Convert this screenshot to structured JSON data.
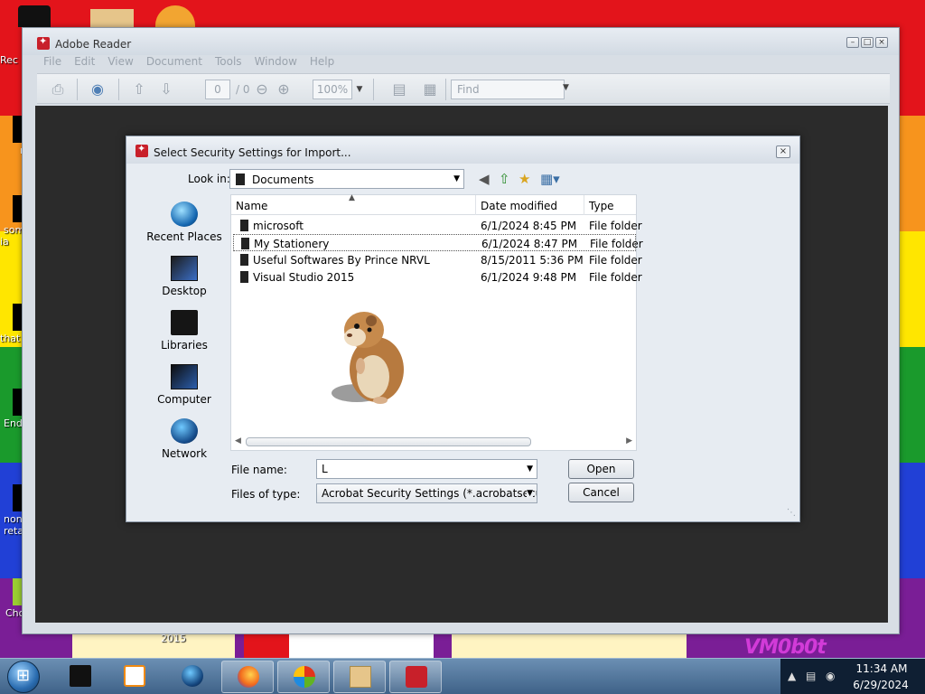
{
  "desktop": {
    "icons": [
      {
        "label": "Rec"
      },
      {
        "label": "r"
      },
      {
        "label": "som ia"
      },
      {
        "label": "that"
      },
      {
        "label": "End"
      },
      {
        "label": "none retar"
      },
      {
        "label": "Cho"
      }
    ],
    "taskbar_year_label": "2015",
    "watermark": "VM0b0t"
  },
  "reader": {
    "title": "Adobe Reader",
    "menu": [
      "File",
      "Edit",
      "View",
      "Document",
      "Tools",
      "Window",
      "Help"
    ],
    "toolbar": {
      "page_current": "0",
      "page_total": "/ 0",
      "zoom": "100%",
      "find_placeholder": "Find"
    }
  },
  "dialog": {
    "title": "Select Security Settings for Import...",
    "look_in_label": "Look in:",
    "look_in_value": "Documents",
    "places": [
      {
        "label": "Recent Places",
        "icon": "recent-places-icon"
      },
      {
        "label": "Desktop",
        "icon": "desktop-icon"
      },
      {
        "label": "Libraries",
        "icon": "libraries-icon"
      },
      {
        "label": "Computer",
        "icon": "computer-icon"
      },
      {
        "label": "Network",
        "icon": "network-icon"
      }
    ],
    "columns": [
      "Name",
      "Date modified",
      "Type"
    ],
    "files": [
      {
        "name": "microsoft",
        "date": "6/1/2024 8:45 PM",
        "type": "File folder"
      },
      {
        "name": "My Stationery",
        "date": "6/1/2024 8:47 PM",
        "type": "File folder"
      },
      {
        "name": "Useful Softwares By Prince NRVL",
        "date": "8/15/2011 5:36 PM",
        "type": "File folder"
      },
      {
        "name": "Visual Studio 2015",
        "date": "6/1/2024 9:48 PM",
        "type": "File folder"
      }
    ],
    "file_name_label": "File name:",
    "file_name_value": "L",
    "file_type_label": "Files of type:",
    "file_type_value": "Acrobat Security Settings (*.acrobatsecuritysetti",
    "open_label": "Open",
    "cancel_label": "Cancel"
  },
  "taskbar": {
    "time": "11:34 AM",
    "date": "6/29/2024"
  }
}
